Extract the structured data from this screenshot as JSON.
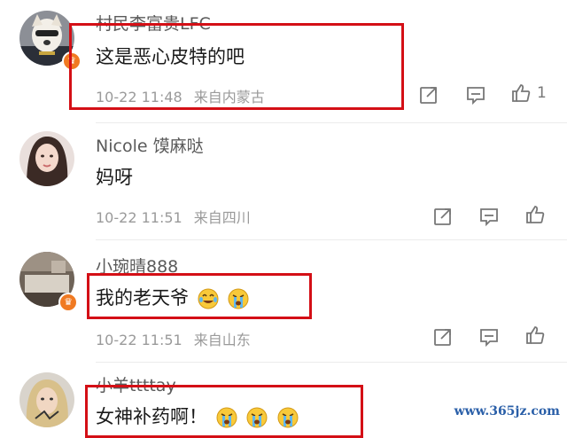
{
  "comments": [
    {
      "username": "村民李富贵LFC",
      "text": "这是恶心皮特的吧",
      "date": "10-22 11:48",
      "location": "来自内蒙古",
      "likes": "1",
      "has_badge": true,
      "emojis": []
    },
    {
      "username": "Nicole 馍麻哒",
      "text": "妈呀",
      "date": "10-22 11:51",
      "location": "来自四川",
      "likes": "",
      "has_badge": false,
      "emojis": []
    },
    {
      "username": "小琬晴888",
      "text": "我的老天爷",
      "date": "10-22 11:51",
      "location": "来自山东",
      "likes": "",
      "has_badge": true,
      "emojis": [
        "laugh-cry-emoji",
        "crying-emoji"
      ]
    },
    {
      "username": "小羊ttttay",
      "text": "女神补药啊！",
      "date": "",
      "location": "",
      "likes": "",
      "has_badge": false,
      "emojis": [
        "crying-emoji",
        "crying-emoji",
        "crying-emoji"
      ]
    }
  ],
  "watermark": "www.365jz.com",
  "colors": {
    "highlight_box": "#d40f16",
    "meta_text": "#9a9a9a",
    "badge": "#f07a22"
  }
}
